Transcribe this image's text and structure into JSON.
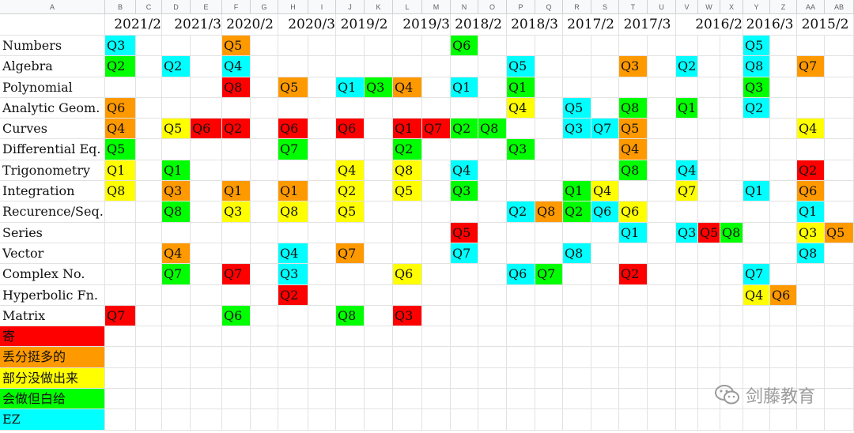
{
  "columns": [
    "A",
    "B",
    "C",
    "D",
    "E",
    "F",
    "G",
    "H",
    "I",
    "J",
    "K",
    "L",
    "M",
    "N",
    "O",
    "P",
    "Q",
    "R",
    "S",
    "T",
    "U",
    "V",
    "W",
    "X",
    "Y",
    "Z",
    "AA",
    "AB"
  ],
  "colors": {
    "hard": "#ff0000",
    "lost": "#ff9900",
    "partial": "#ffff00",
    "careless": "#00ff00",
    "ez": "#00ffff"
  },
  "years": [
    {
      "label": "2021/2",
      "start": "B",
      "span": 2,
      "align": "right"
    },
    {
      "label": "2021/3",
      "start": "D",
      "span": 2,
      "align": "right"
    },
    {
      "label": "2020/2",
      "start": "F",
      "span": 2,
      "align": "center"
    },
    {
      "label": "2020/3",
      "start": "H",
      "span": 2,
      "align": "right"
    },
    {
      "label": "2019/2",
      "start": "J",
      "span": 2,
      "align": "center"
    },
    {
      "label": "2019/3",
      "start": "L",
      "span": 2,
      "align": "right"
    },
    {
      "label": "2018/2",
      "start": "N",
      "span": 2,
      "align": "center"
    },
    {
      "label": "2018/3",
      "start": "P",
      "span": 2,
      "align": "center"
    },
    {
      "label": "2017/2",
      "start": "R",
      "span": 2,
      "align": "center"
    },
    {
      "label": "2017/3",
      "start": "T",
      "span": 2,
      "align": "center"
    },
    {
      "label": "2016/2",
      "start": "V",
      "span": 3,
      "align": "right"
    },
    {
      "label": "2016/3",
      "start": "Y",
      "span": 2,
      "align": "center"
    },
    {
      "label": "2015/2",
      "start": "AA",
      "span": 2,
      "align": "center"
    }
  ],
  "rows": [
    {
      "label": "Numbers",
      "cells": [
        [
          "B",
          "Q3",
          "ez"
        ],
        [
          "F",
          "Q5",
          "lost"
        ],
        [
          "N",
          "Q6",
          "careless"
        ],
        [
          "Y",
          "Q5",
          "ez"
        ]
      ]
    },
    {
      "label": "Algebra",
      "cells": [
        [
          "B",
          "Q2",
          "careless"
        ],
        [
          "D",
          "Q2",
          "ez"
        ],
        [
          "F",
          "Q4",
          "ez"
        ],
        [
          "P",
          "Q5",
          "ez"
        ],
        [
          "T",
          "Q3",
          "lost"
        ],
        [
          "V",
          "Q2",
          "ez"
        ],
        [
          "Y",
          "Q8",
          "ez"
        ],
        [
          "AA",
          "Q7",
          "lost"
        ]
      ]
    },
    {
      "label": "Polynomial",
      "cells": [
        [
          "F",
          "Q8",
          "hard"
        ],
        [
          "H",
          "Q5",
          "lost"
        ],
        [
          "J",
          "Q1",
          "ez"
        ],
        [
          "K",
          "Q3",
          "careless"
        ],
        [
          "L",
          "Q4",
          "lost"
        ],
        [
          "N",
          "Q1",
          "ez"
        ],
        [
          "P",
          "Q1",
          "careless"
        ],
        [
          "Y",
          "Q3",
          "careless"
        ]
      ]
    },
    {
      "label": "Analytic Geom.",
      "cells": [
        [
          "B",
          "Q6",
          "lost"
        ],
        [
          "P",
          "Q4",
          "partial"
        ],
        [
          "R",
          "Q5",
          "ez"
        ],
        [
          "T",
          "Q8",
          "careless"
        ],
        [
          "V",
          "Q1",
          "careless"
        ],
        [
          "Y",
          "Q2",
          "ez"
        ]
      ]
    },
    {
      "label": "Curves",
      "cells": [
        [
          "B",
          "Q4",
          "lost"
        ],
        [
          "D",
          "Q5",
          "partial"
        ],
        [
          "E",
          "Q6",
          "hard"
        ],
        [
          "F",
          "Q2",
          "hard"
        ],
        [
          "H",
          "Q6",
          "hard"
        ],
        [
          "J",
          "Q6",
          "hard"
        ],
        [
          "L",
          "Q1",
          "hard"
        ],
        [
          "M",
          "Q7",
          "hard"
        ],
        [
          "N",
          "Q2",
          "careless"
        ],
        [
          "O",
          "Q8",
          "careless"
        ],
        [
          "R",
          "Q3",
          "ez"
        ],
        [
          "S",
          "Q7",
          "ez"
        ],
        [
          "T",
          "Q5",
          "lost"
        ],
        [
          "AA",
          "Q4",
          "partial"
        ]
      ]
    },
    {
      "label": "Differential Eq.",
      "cells": [
        [
          "B",
          "Q5",
          "careless"
        ],
        [
          "H",
          "Q7",
          "careless"
        ],
        [
          "L",
          "Q2",
          "careless"
        ],
        [
          "P",
          "Q3",
          "careless"
        ],
        [
          "T",
          "Q4",
          "lost"
        ]
      ]
    },
    {
      "label": "Trigonometry",
      "cells": [
        [
          "B",
          "Q1",
          "partial"
        ],
        [
          "D",
          "Q1",
          "careless"
        ],
        [
          "J",
          "Q4",
          "partial"
        ],
        [
          "L",
          "Q8",
          "partial"
        ],
        [
          "N",
          "Q4",
          "ez"
        ],
        [
          "T",
          "Q8",
          "careless"
        ],
        [
          "V",
          "Q4",
          "ez"
        ],
        [
          "AA",
          "Q2",
          "hard"
        ]
      ]
    },
    {
      "label": "Integration",
      "cells": [
        [
          "B",
          "Q8",
          "partial"
        ],
        [
          "D",
          "Q3",
          "lost"
        ],
        [
          "F",
          "Q1",
          "lost"
        ],
        [
          "H",
          "Q1",
          "lost"
        ],
        [
          "J",
          "Q2",
          "partial"
        ],
        [
          "L",
          "Q5",
          "partial"
        ],
        [
          "N",
          "Q3",
          "careless"
        ],
        [
          "R",
          "Q1",
          "careless"
        ],
        [
          "S",
          "Q4",
          "partial"
        ],
        [
          "V",
          "Q7",
          "partial"
        ],
        [
          "Y",
          "Q1",
          "ez"
        ],
        [
          "AA",
          "Q6",
          "lost"
        ]
      ]
    },
    {
      "label": "Recurence/Seq.",
      "cells": [
        [
          "D",
          "Q8",
          "careless"
        ],
        [
          "F",
          "Q3",
          "partial"
        ],
        [
          "H",
          "Q8",
          "partial"
        ],
        [
          "J",
          "Q5",
          "partial"
        ],
        [
          "P",
          "Q2",
          "ez"
        ],
        [
          "Q",
          "Q8",
          "lost"
        ],
        [
          "R",
          "Q2",
          "careless"
        ],
        [
          "S",
          "Q6",
          "ez"
        ],
        [
          "T",
          "Q6",
          "partial"
        ],
        [
          "AA",
          "Q1",
          "ez"
        ]
      ]
    },
    {
      "label": "Series",
      "cells": [
        [
          "N",
          "Q5",
          "hard"
        ],
        [
          "T",
          "Q1",
          "ez"
        ],
        [
          "V",
          "Q3",
          "ez"
        ],
        [
          "W",
          "Q5",
          "hard"
        ],
        [
          "X",
          "Q8",
          "careless"
        ],
        [
          "AA",
          "Q3",
          "partial"
        ],
        [
          "AB",
          "Q5",
          "lost"
        ]
      ]
    },
    {
      "label": "Vector",
      "cells": [
        [
          "D",
          "Q4",
          "lost"
        ],
        [
          "H",
          "Q4",
          "ez"
        ],
        [
          "J",
          "Q7",
          "lost"
        ],
        [
          "N",
          "Q7",
          "ez"
        ],
        [
          "R",
          "Q8",
          "ez"
        ],
        [
          "AA",
          "Q8",
          "ez"
        ]
      ]
    },
    {
      "label": "Complex No.",
      "cells": [
        [
          "D",
          "Q7",
          "careless"
        ],
        [
          "F",
          "Q7",
          "hard"
        ],
        [
          "H",
          "Q3",
          "ez"
        ],
        [
          "L",
          "Q6",
          "partial"
        ],
        [
          "P",
          "Q6",
          "ez"
        ],
        [
          "Q",
          "Q7",
          "careless"
        ],
        [
          "T",
          "Q2",
          "hard"
        ],
        [
          "Y",
          "Q7",
          "ez"
        ]
      ]
    },
    {
      "label": "Hyperbolic Fn.",
      "cells": [
        [
          "H",
          "Q2",
          "hard"
        ],
        [
          "Y",
          "Q4",
          "partial"
        ],
        [
          "Z",
          "Q6",
          "lost"
        ]
      ]
    },
    {
      "label": "Matrix",
      "cells": [
        [
          "B",
          "Q7",
          "hard"
        ],
        [
          "F",
          "Q6",
          "careless"
        ],
        [
          "J",
          "Q8",
          "careless"
        ],
        [
          "L",
          "Q3",
          "hard"
        ]
      ]
    }
  ],
  "legend": [
    {
      "label": "寄",
      "level": "hard"
    },
    {
      "label": "丢分挺多的",
      "level": "lost"
    },
    {
      "label": "部分没做出来",
      "level": "partial"
    },
    {
      "label": "会做但白给",
      "level": "careless"
    },
    {
      "label": "EZ",
      "level": "ez"
    }
  ],
  "watermark": {
    "text": "剑藤教育",
    "icon": "wechat-icon"
  }
}
